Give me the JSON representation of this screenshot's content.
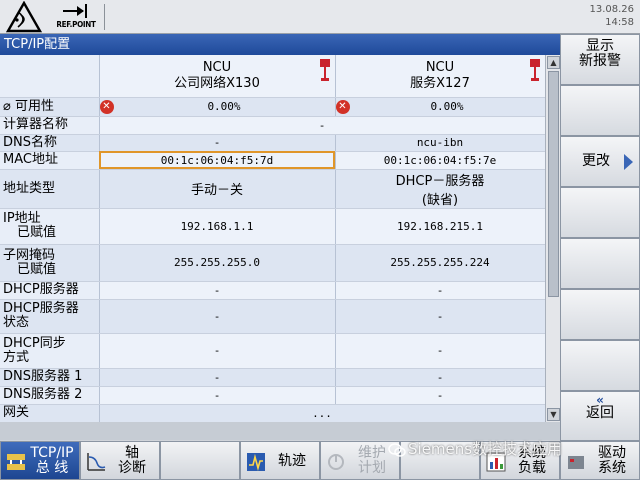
{
  "header": {
    "ref_point_label": "REF.POINT",
    "date": "13.08.26",
    "time": "14:58"
  },
  "panel": {
    "title": "TCP/IP配置",
    "col1_header_line1": "NCU",
    "col1_header_line2": "公司网络X130",
    "col2_header_line1": "NCU",
    "col2_header_line2": "服务X127"
  },
  "rows": {
    "availability": {
      "label": "⌀ 可用性",
      "v1": "0.00%",
      "v2": "0.00%"
    },
    "computer_name": {
      "label": "计算器名称",
      "v": "-"
    },
    "dns_name": {
      "label": "DNS名称",
      "v1": "-",
      "v2": "ncu-ibn"
    },
    "mac": {
      "label": "MAC地址",
      "v1": "00:1c:06:04:f5:7d",
      "v2": "00:1c:06:04:f5:7e"
    },
    "addr_type": {
      "label": "地址类型",
      "v1": "手动－关",
      "v2_line1": "DHCP－服务器",
      "v2_line2": "(缺省)"
    },
    "ip": {
      "label_line1": "IP地址",
      "label_line2": "已赋值",
      "v1": "192.168.1.1",
      "v2": "192.168.215.1"
    },
    "subnet": {
      "label_line1": "子网掩码",
      "label_line2": "已赋值",
      "v1": "255.255.255.0",
      "v2": "255.255.255.224"
    },
    "dhcp_server": {
      "label": "DHCP服务器",
      "v1": "-",
      "v2": "-"
    },
    "dhcp_status": {
      "label_line1": "DHCP服务器",
      "label_line2": "状态",
      "v1": "-",
      "v2": "-"
    },
    "dhcp_sync": {
      "label_line1": "DHCP同步",
      "label_line2": "方式",
      "v1": "-",
      "v2": "-"
    },
    "dns1": {
      "label": "DNS服务器 1",
      "v1": "-",
      "v2": "-"
    },
    "dns2": {
      "label": "DNS服务器 2",
      "v1": "-",
      "v2": "-"
    },
    "gateway": {
      "label": "网关",
      "v": "..."
    }
  },
  "vertical_softkeys": {
    "show_new_alarm_line1": "显示",
    "show_new_alarm_line2": "新报警",
    "change": "更改",
    "back": "返回"
  },
  "horizontal_softkeys": {
    "tcpip_line1": "TCP/IP",
    "tcpip_line2": "总 线",
    "axis_line1": "轴",
    "axis_line2": "诊断",
    "trace": "轨迹",
    "maint_line1": "维护",
    "maint_line2": "计划",
    "sysload_line1": "系统",
    "sysload_line2": "负载",
    "start_line1": "驱动",
    "start_line2": "系统"
  },
  "watermark": "Siemens数控技术应用",
  "colors": {
    "title_bar": "#1f4a9a",
    "selection": "#e0962a",
    "error": "#d23227"
  }
}
